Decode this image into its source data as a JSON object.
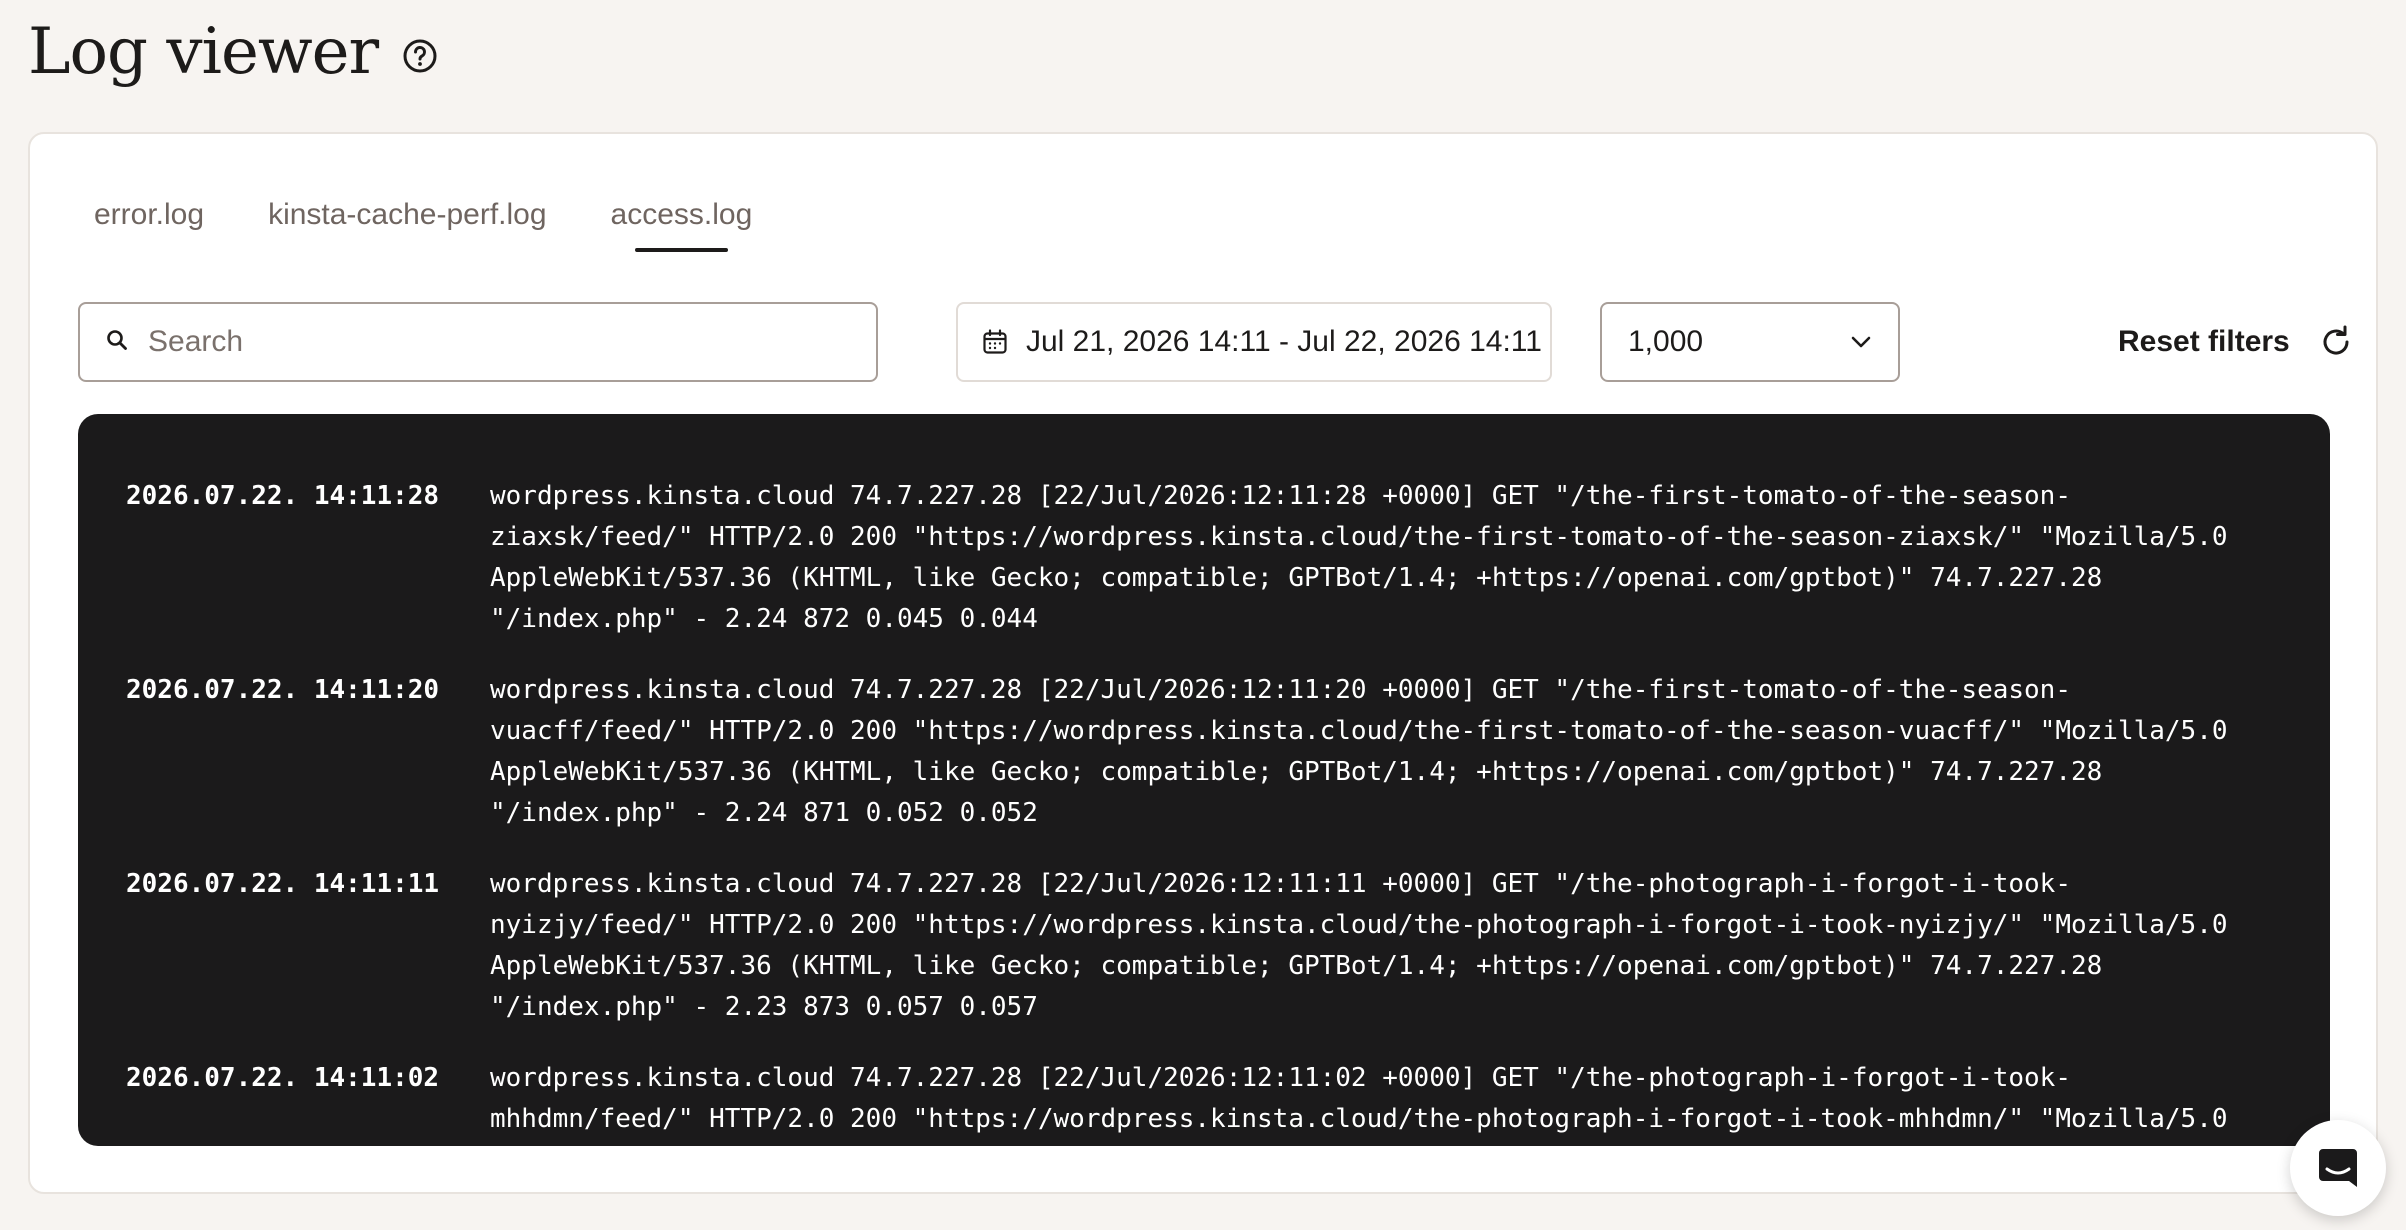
{
  "header": {
    "title": "Log viewer"
  },
  "tabs": [
    {
      "label": "error.log",
      "active": false
    },
    {
      "label": "kinsta-cache-perf.log",
      "active": false
    },
    {
      "label": "access.log",
      "active": true
    }
  ],
  "toolbar": {
    "search_placeholder": "Search",
    "search_value": "",
    "date_range": "Jul 21, 2026 14:11 - Jul 22, 2026 14:11",
    "limit_value": "1,000",
    "reset_label": "Reset filters"
  },
  "logs": [
    {
      "time": "2026.07.22. 14:11:28",
      "message": "wordpress.kinsta.cloud 74.7.227.28 [22/Jul/2026:12:11:28 +0000] GET \"/the-first-tomato-of-the-season-\nziaxsk/feed/\" HTTP/2.0 200 \"https://wordpress.kinsta.cloud/the-first-tomato-of-the-season-ziaxsk/\" \"Mozilla/5.0\nAppleWebKit/537.36 (KHTML, like Gecko; compatible; GPTBot/1.4; +https://openai.com/gptbot)\" 74.7.227.28\n\"/index.php\" - 2.24 872 0.045 0.044"
    },
    {
      "time": "2026.07.22. 14:11:20",
      "message": "wordpress.kinsta.cloud 74.7.227.28 [22/Jul/2026:12:11:20 +0000] GET \"/the-first-tomato-of-the-season-\nvuacff/feed/\" HTTP/2.0 200 \"https://wordpress.kinsta.cloud/the-first-tomato-of-the-season-vuacff/\" \"Mozilla/5.0\nAppleWebKit/537.36 (KHTML, like Gecko; compatible; GPTBot/1.4; +https://openai.com/gptbot)\" 74.7.227.28\n\"/index.php\" - 2.24 871 0.052 0.052"
    },
    {
      "time": "2026.07.22. 14:11:11",
      "message": "wordpress.kinsta.cloud 74.7.227.28 [22/Jul/2026:12:11:11 +0000] GET \"/the-photograph-i-forgot-i-took-\nnyizjy/feed/\" HTTP/2.0 200 \"https://wordpress.kinsta.cloud/the-photograph-i-forgot-i-took-nyizjy/\" \"Mozilla/5.0\nAppleWebKit/537.36 (KHTML, like Gecko; compatible; GPTBot/1.4; +https://openai.com/gptbot)\" 74.7.227.28\n\"/index.php\" - 2.23 873 0.057 0.057"
    },
    {
      "time": "2026.07.22. 14:11:02",
      "message": "wordpress.kinsta.cloud 74.7.227.28 [22/Jul/2026:12:11:02 +0000] GET \"/the-photograph-i-forgot-i-took-\nmhhdmn/feed/\" HTTP/2.0 200 \"https://wordpress.kinsta.cloud/the-photograph-i-forgot-i-took-mhhdmn/\" \"Mozilla/5.0"
    }
  ],
  "icons": {
    "help": "question-circle-icon",
    "search": "search-icon",
    "calendar": "calendar-icon",
    "chevron": "chevron-down-icon",
    "refresh": "refresh-icon",
    "chat": "chat-icon"
  },
  "colors": {
    "background": "#f7f4f1",
    "card": "#ffffff",
    "log_panel": "#1b1a1b",
    "text": "#1d1b1a",
    "muted_text": "#6f6560"
  }
}
